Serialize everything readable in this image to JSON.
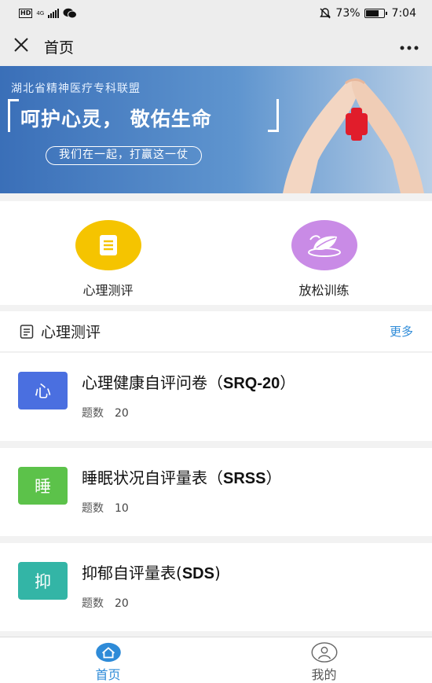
{
  "status_bar": {
    "hd": "HD",
    "network": "4G",
    "battery_percent": "73%",
    "battery_level": 0.73,
    "time": "7:04",
    "icons": [
      "signal-icon",
      "wechat-icon",
      "mute-icon",
      "battery-icon"
    ]
  },
  "nav": {
    "close_icon": "close-icon",
    "title": "首页",
    "more_icon": "more-icon"
  },
  "banner": {
    "subtitle": "湖北省精神医疗专科联盟",
    "title": "呵护心灵， 敬佑生命",
    "slogan": "我们在一起，打赢这一仗"
  },
  "shortcuts": [
    {
      "label": "心理测评",
      "icon": "document-icon",
      "color": "#f5c400"
    },
    {
      "label": "放松训练",
      "icon": "leaf-icon",
      "color": "#c98be6"
    }
  ],
  "section": {
    "title": "心理测评",
    "more": "更多",
    "icon": "document-outline-icon"
  },
  "assessments": [
    {
      "badge": "心",
      "badge_color": "#4a6fe0",
      "title_cn": "心理健康自评问卷（",
      "title_code": "SRQ-20",
      "title_end": "）",
      "count_label": "题数",
      "count": "20"
    },
    {
      "badge": "睡",
      "badge_color": "#5cc24a",
      "title_cn": "睡眠状况自评量表（",
      "title_code": "SRSS",
      "title_end": "）",
      "count_label": "题数",
      "count": "10"
    },
    {
      "badge": "抑",
      "badge_color": "#33b5a6",
      "title_cn": "抑郁自评量表(",
      "title_code": "SDS",
      "title_end": ")",
      "count_label": "题数",
      "count": "20"
    }
  ],
  "tabbar": [
    {
      "label": "首页",
      "icon": "home-icon",
      "active": true,
      "color": "#2e8bd8"
    },
    {
      "label": "我的",
      "icon": "user-icon",
      "active": false,
      "color": "#555555"
    }
  ]
}
